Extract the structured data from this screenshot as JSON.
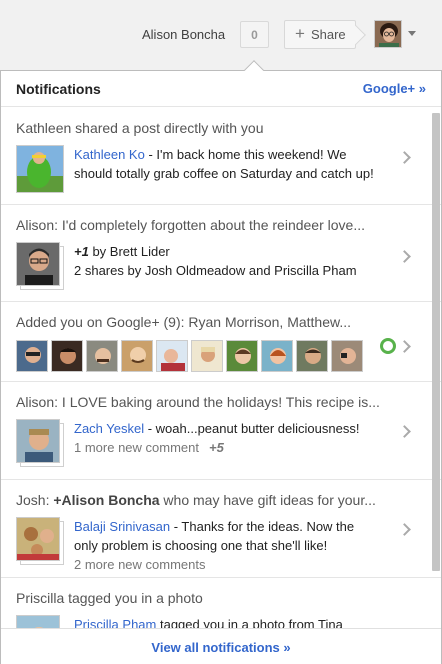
{
  "header": {
    "user_name": "Alison Boncha",
    "notification_count": "0",
    "share_label": "Share"
  },
  "panel": {
    "title": "Notifications",
    "gplus_link": "Google+ »",
    "footer_link": "View all notifications »"
  },
  "notifications": [
    {
      "summary": "Kathleen shared a post directly with you",
      "author": "Kathleen Ko",
      "text_line1": " - I'm back home this weekend! We",
      "text_line2": "should totally grab coffee on Saturday and catch up!"
    },
    {
      "summary": "Alison: I'd completely forgotten about the reindeer love...",
      "plus_one": "+1",
      "plus_one_rest": " by Brett Lider",
      "shares": "2 shares by Josh Oldmeadow and Priscilla Pham"
    },
    {
      "summary": "Added you on Google+ (9): Ryan Morrison, Matthew..."
    },
    {
      "summary": "Alison: I LOVE baking around the holidays! This recipe is...",
      "author": "Zach Yeskel",
      "text_line1": " - woah...peanut butter deliciousness!",
      "meta": "1 more new comment",
      "plus_count": "+5"
    },
    {
      "summary_prefix": "Josh: ",
      "summary_bold": "+Alison Boncha",
      "summary_rest": " who may have gift ideas for your...",
      "author": "Balaji Srinivasan",
      "text_line1": "  - Thanks for the ideas. Now the",
      "text_line2": "only problem is choosing one that she'll like!",
      "meta": "2 more new comments"
    },
    {
      "summary": "Priscilla tagged you in a photo",
      "author": "Priscilla Pham",
      "text_line1": " tagged you in a photo from Tina"
    }
  ],
  "colors": {
    "link": "#3366cc",
    "circle_green": "#58b24b"
  }
}
